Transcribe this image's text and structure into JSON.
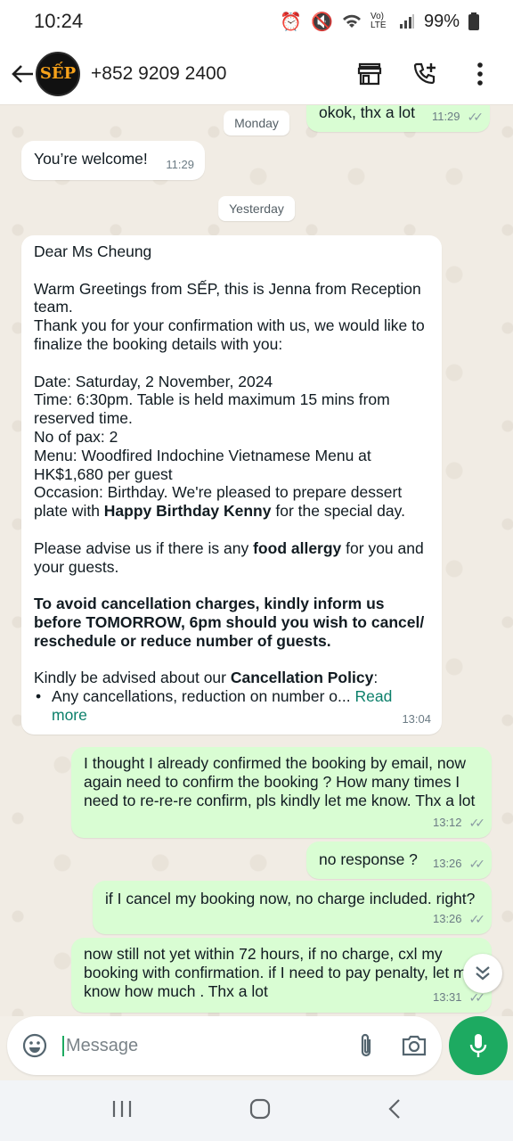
{
  "status": {
    "time": "10:24",
    "network": "Vo) LTE",
    "battery": "99%"
  },
  "header": {
    "avatar_text": "SẾP",
    "contact": "+852 9209 2400"
  },
  "chat": {
    "msg_top": {
      "text": "okok, thx a lot",
      "time": "11:29"
    },
    "date_monday": "Monday",
    "msg_welcome": {
      "text": "You’re welcome!",
      "time": "11:29"
    },
    "date_yesterday": "Yesterday",
    "long_msg": {
      "line1": "Dear Ms Cheung",
      "p2": "Warm Greetings from SẾP, this is Jenna from Reception team.",
      "p3": "Thank you for your confirmation with us, we would like to finalize the booking details with you:",
      "date": "Date: Saturday, 2 November, 2024",
      "time": "Time:  6:30pm. Table is held maximum 15 mins from reserved time.",
      "pax": "No of pax: 2",
      "menu": "Menu:  Woodfired Indochine Vietnamese Menu at HK$1,680 per guest",
      "occasion_a": "Occasion: Birthday. We're pleased to prepare dessert plate with ",
      "occasion_b": "Happy Birthday Kenny",
      "occasion_c": " for the special day.",
      "allergy_a": "Please advise us if there is any ",
      "allergy_b": "food allergy",
      "allergy_c": " for you and your guests.",
      "cancel_bold": "To avoid cancellation charges, kindly inform us before TOMORROW, 6pm should you wish to cancel/ reschedule or reduce number of guests.",
      "policy_a": "Kindly be advised about our ",
      "policy_b": "Cancellation Policy",
      "policy_c": ":",
      "bullet": "Any cancellations, reduction on number o... ",
      "read_more": "Read more",
      "msg_time": "13:04"
    },
    "out1": {
      "text": "I thought I already confirmed the booking by email, now again need to confirm the booking ? How many times I need to re-re-re confirm, pls kindly let me know. Thx a lot",
      "time": "13:12"
    },
    "out2": {
      "text": "no response ?",
      "time": "13:26"
    },
    "out3": {
      "text": "if I cancel my booking now, no charge included. right?",
      "time": "13:26"
    },
    "out4": {
      "text": "now still not yet within 72 hours, if no charge, cxl my booking with confirmation. if I need to pay penalty, let me know how much . Thx a lot",
      "time": "13:31"
    }
  },
  "composer": {
    "placeholder": "Message"
  }
}
